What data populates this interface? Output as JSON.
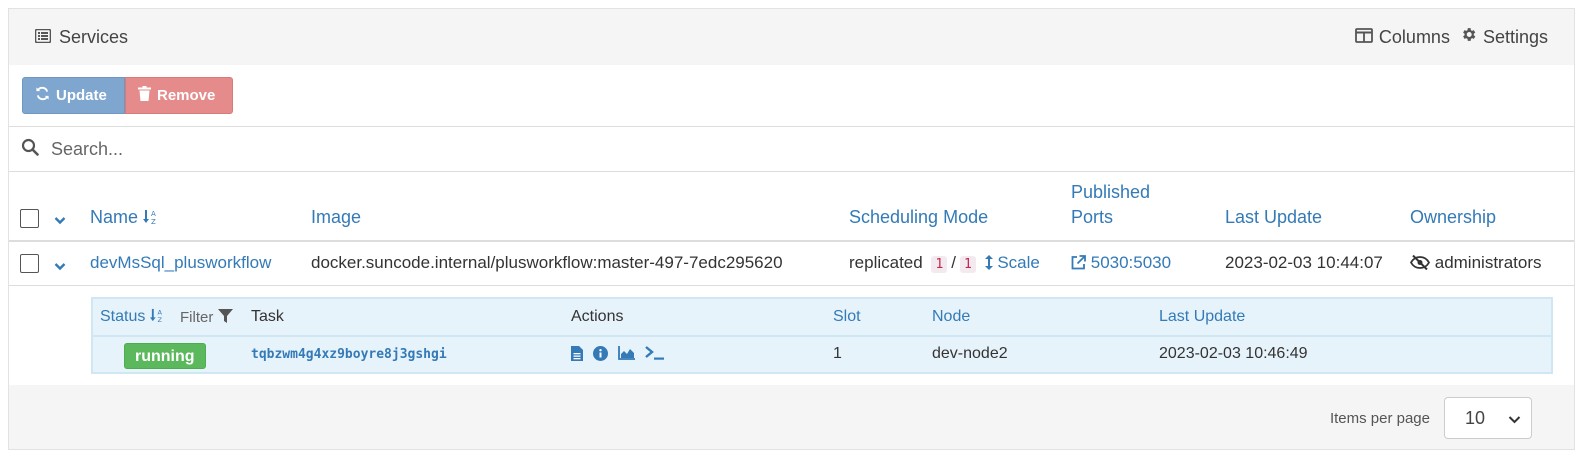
{
  "header": {
    "title": "Services",
    "columns_label": "Columns",
    "settings_label": "Settings"
  },
  "toolbar": {
    "update_label": "Update",
    "remove_label": "Remove"
  },
  "search": {
    "placeholder": "Search..."
  },
  "table": {
    "columns": {
      "name": "Name",
      "image": "Image",
      "scheduling_mode": "Scheduling Mode",
      "published_ports_line1": "Published",
      "published_ports_line2": "Ports",
      "last_update": "Last Update",
      "ownership": "Ownership"
    },
    "rows": [
      {
        "name": "devMsSql_plusworkflow",
        "image": "docker.suncode.internal/plusworkflow:master-497-7edc295620",
        "mode": "replicated",
        "replicas_running": "1",
        "separator": "/",
        "replicas_desired": "1",
        "scale_label": "Scale",
        "ports": "5030:5030",
        "last_update": "2023-02-03 10:44:07",
        "ownership": "administrators"
      }
    ]
  },
  "tasks": {
    "columns": {
      "status": "Status",
      "filter": "Filter",
      "task": "Task",
      "actions": "Actions",
      "slot": "Slot",
      "node": "Node",
      "last_update": "Last Update"
    },
    "rows": [
      {
        "status": "running",
        "task_id": "tqbzwm4g4xz9boyre8j3gshgi",
        "slot": "1",
        "node": "dev-node2",
        "last_update": "2023-02-03 10:46:49"
      }
    ]
  },
  "footer": {
    "items_per_page_label": "Items per page",
    "items_per_page_value": "10"
  },
  "colors": {
    "link": "#337ab7",
    "update_button": "#7fa6cf",
    "remove_button": "#e58b8b",
    "running_badge": "#5cb85c"
  }
}
